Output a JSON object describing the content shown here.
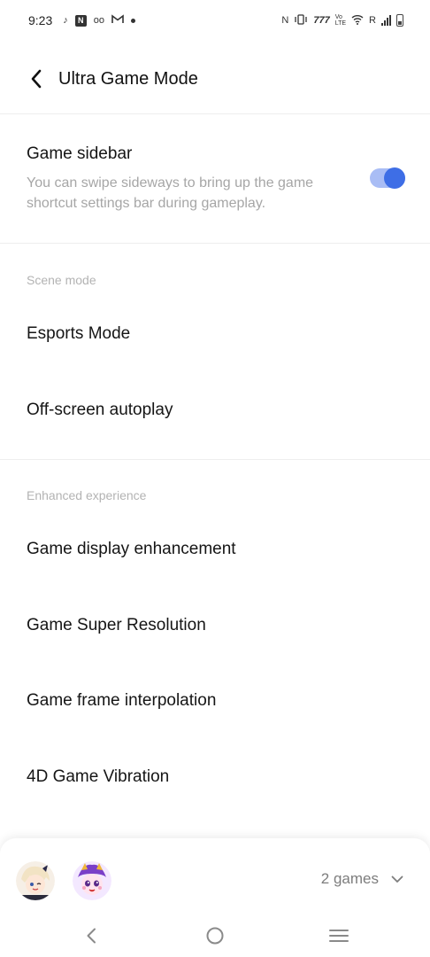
{
  "status_bar": {
    "time": "9:23",
    "network_label": "R",
    "icons": [
      "tiktok-icon",
      "n-app-icon",
      "voicemail-icon",
      "gmail-icon",
      "notification-dot",
      "nfc-icon",
      "vibrate-icon",
      "volte-icon",
      "wifi-icon",
      "signal-icon",
      "battery-icon"
    ]
  },
  "header": {
    "title": "Ultra Game Mode"
  },
  "game_sidebar": {
    "title": "Game sidebar",
    "description": "You can swipe sideways to bring up the game shortcut settings bar during gameplay.",
    "enabled": true
  },
  "sections": [
    {
      "header": "Scene mode",
      "items": [
        "Esports Mode",
        "Off-screen autoplay"
      ]
    },
    {
      "header": "Enhanced experience",
      "items": [
        "Game display enhancement",
        "Game Super Resolution",
        "Game frame interpolation",
        "4D Game Vibration"
      ]
    }
  ],
  "games_panel": {
    "count_label": "2 games"
  },
  "colors": {
    "accent": "#3e6ee6",
    "toggle_track": "#a9bdf5",
    "secondary_text": "#a6a6a6"
  }
}
